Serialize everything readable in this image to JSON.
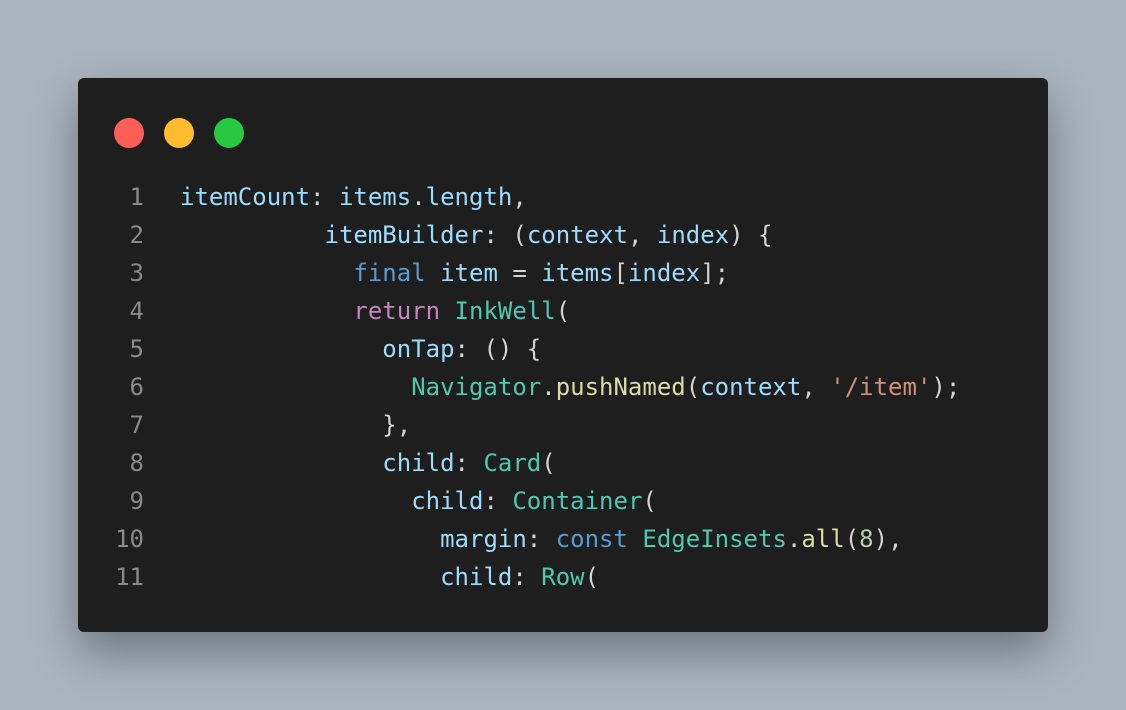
{
  "colors": {
    "background": "#a9b4bf",
    "editor": "#1e1e1e",
    "line_numbers": "#8a8a8a",
    "default": "#d4d4d4",
    "variable": "#9cdcfe",
    "keyword": "#569cd6",
    "control": "#c586c0",
    "class": "#4ec9b0",
    "function": "#dcdcaa",
    "string": "#ce9178",
    "number": "#b5cea8"
  },
  "window_controls": [
    {
      "name": "close-dot",
      "color": "#ff5f57"
    },
    {
      "name": "minimize-dot",
      "color": "#febc2e"
    },
    {
      "name": "maximize-dot",
      "color": "#28c840"
    }
  ],
  "code": {
    "lines": [
      {
        "n": "1",
        "tokens": [
          {
            "t": "itemCount",
            "c": "variable"
          },
          {
            "t": ": ",
            "c": "default"
          },
          {
            "t": "items",
            "c": "variable"
          },
          {
            "t": ".",
            "c": "default"
          },
          {
            "t": "length",
            "c": "variable"
          },
          {
            "t": ",",
            "c": "default"
          }
        ]
      },
      {
        "n": "2",
        "tokens": [
          {
            "t": "          ",
            "c": "default"
          },
          {
            "t": "itemBuilder",
            "c": "variable"
          },
          {
            "t": ": (",
            "c": "default"
          },
          {
            "t": "context",
            "c": "variable"
          },
          {
            "t": ", ",
            "c": "default"
          },
          {
            "t": "index",
            "c": "variable"
          },
          {
            "t": ") {",
            "c": "default"
          }
        ]
      },
      {
        "n": "3",
        "tokens": [
          {
            "t": "            ",
            "c": "default"
          },
          {
            "t": "final",
            "c": "keyword"
          },
          {
            "t": " ",
            "c": "default"
          },
          {
            "t": "item",
            "c": "variable"
          },
          {
            "t": " = ",
            "c": "default"
          },
          {
            "t": "items",
            "c": "variable"
          },
          {
            "t": "[",
            "c": "default"
          },
          {
            "t": "index",
            "c": "variable"
          },
          {
            "t": "];",
            "c": "default"
          }
        ]
      },
      {
        "n": "4",
        "tokens": [
          {
            "t": "            ",
            "c": "default"
          },
          {
            "t": "return",
            "c": "control"
          },
          {
            "t": " ",
            "c": "default"
          },
          {
            "t": "InkWell",
            "c": "class"
          },
          {
            "t": "(",
            "c": "default"
          }
        ]
      },
      {
        "n": "5",
        "tokens": [
          {
            "t": "              ",
            "c": "default"
          },
          {
            "t": "onTap",
            "c": "variable"
          },
          {
            "t": ": () {",
            "c": "default"
          }
        ]
      },
      {
        "n": "6",
        "tokens": [
          {
            "t": "                ",
            "c": "default"
          },
          {
            "t": "Navigator",
            "c": "class"
          },
          {
            "t": ".",
            "c": "default"
          },
          {
            "t": "pushNamed",
            "c": "function"
          },
          {
            "t": "(",
            "c": "default"
          },
          {
            "t": "context",
            "c": "variable"
          },
          {
            "t": ", ",
            "c": "default"
          },
          {
            "t": "'/item'",
            "c": "string"
          },
          {
            "t": ");",
            "c": "default"
          }
        ]
      },
      {
        "n": "7",
        "tokens": [
          {
            "t": "              ",
            "c": "default"
          },
          {
            "t": "},",
            "c": "default"
          }
        ]
      },
      {
        "n": "8",
        "tokens": [
          {
            "t": "              ",
            "c": "default"
          },
          {
            "t": "child",
            "c": "variable"
          },
          {
            "t": ": ",
            "c": "default"
          },
          {
            "t": "Card",
            "c": "class"
          },
          {
            "t": "(",
            "c": "default"
          }
        ]
      },
      {
        "n": "9",
        "tokens": [
          {
            "t": "                ",
            "c": "default"
          },
          {
            "t": "child",
            "c": "variable"
          },
          {
            "t": ": ",
            "c": "default"
          },
          {
            "t": "Container",
            "c": "class"
          },
          {
            "t": "(",
            "c": "default"
          }
        ]
      },
      {
        "n": "10",
        "tokens": [
          {
            "t": "                  ",
            "c": "default"
          },
          {
            "t": "margin",
            "c": "variable"
          },
          {
            "t": ": ",
            "c": "default"
          },
          {
            "t": "const",
            "c": "keyword"
          },
          {
            "t": " ",
            "c": "default"
          },
          {
            "t": "EdgeInsets",
            "c": "class"
          },
          {
            "t": ".",
            "c": "default"
          },
          {
            "t": "all",
            "c": "function"
          },
          {
            "t": "(",
            "c": "default"
          },
          {
            "t": "8",
            "c": "number"
          },
          {
            "t": "),",
            "c": "default"
          }
        ]
      },
      {
        "n": "11",
        "tokens": [
          {
            "t": "                  ",
            "c": "default"
          },
          {
            "t": "child",
            "c": "variable"
          },
          {
            "t": ": ",
            "c": "default"
          },
          {
            "t": "Row",
            "c": "class"
          },
          {
            "t": "(",
            "c": "default"
          }
        ]
      }
    ]
  }
}
